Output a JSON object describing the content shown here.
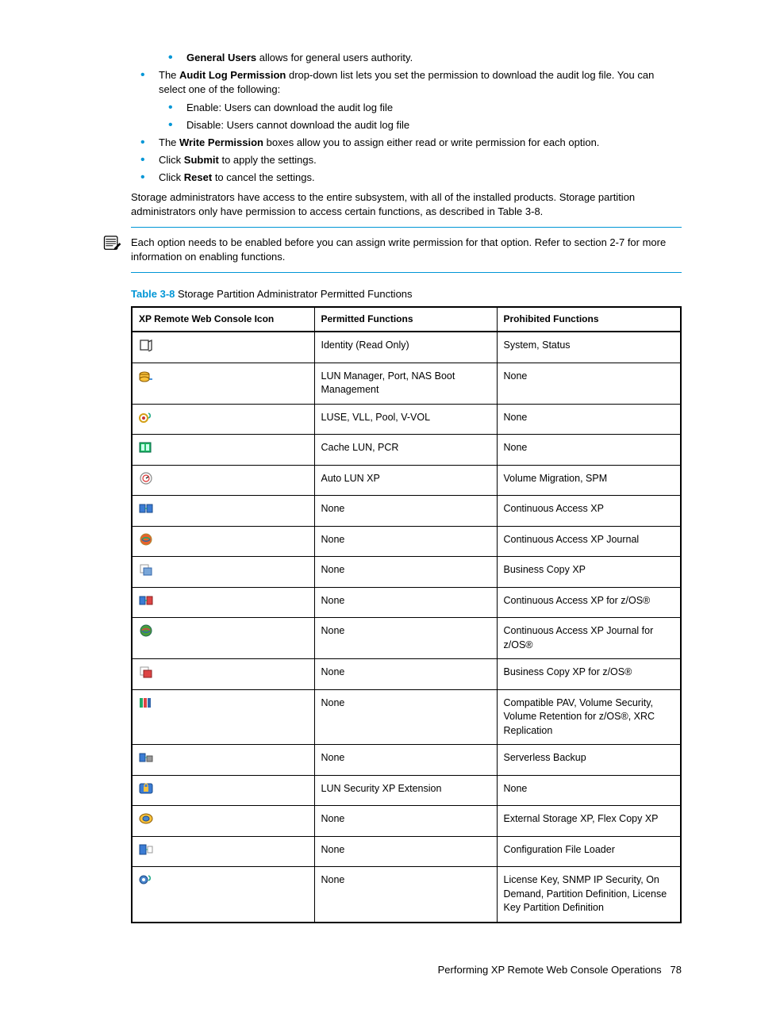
{
  "bullets_l2_top": [
    "General Users"
  ],
  "bullets_l2_top_desc": " allows for general users authority.",
  "bullet_audit_pre": "The ",
  "bullet_audit_bold": "Audit Log Permission",
  "bullet_audit_post": " drop-down list lets you set the permission to download the audit log file. You can select one of the following:",
  "audit_sub": [
    "Enable: Users can download the audit log file",
    "Disable: Users cannot download the audit log file"
  ],
  "bullet_write_pre": "The ",
  "bullet_write_bold": "Write Permission",
  "bullet_write_post": " boxes allow you to assign either read or write permission for each option.",
  "bullet_submit_pre": "Click ",
  "bullet_submit_bold": "Submit",
  "bullet_submit_post": " to apply the settings.",
  "bullet_reset_pre": "Click ",
  "bullet_reset_bold": "Reset",
  "bullet_reset_post": " to cancel the settings.",
  "para1": "Storage administrators have access to the entire subsystem, with all of the installed products. Storage partition administrators only have permission to access certain functions, as described in Table 3-8.",
  "note": "Each option needs to be enabled before you can assign write permission for that option. Refer to section 2-7 for more information on enabling functions.",
  "table_label": "Table 3-8",
  "table_caption": "  Storage Partition Administrator Permitted Functions",
  "headers": {
    "c1": "XP Remote Web Console Icon",
    "c2": "Permitted Functions",
    "c3": "Prohibited Functions"
  },
  "rows": [
    {
      "icon": "identity-icon",
      "permitted": "Identity (Read Only)",
      "prohibited": "System, Status"
    },
    {
      "icon": "lun-manager-icon",
      "permitted": "LUN Manager, Port, NAS Boot Management",
      "prohibited": "None"
    },
    {
      "icon": "luse-icon",
      "permitted": "LUSE, VLL, Pool, V-VOL",
      "prohibited": "None"
    },
    {
      "icon": "cache-lun-icon",
      "permitted": "Cache LUN, PCR",
      "prohibited": "None"
    },
    {
      "icon": "auto-lun-icon",
      "permitted": "Auto LUN XP",
      "prohibited": "Volume Migration, SPM"
    },
    {
      "icon": "ca-xp-icon",
      "permitted": "None",
      "prohibited": "Continuous Access XP"
    },
    {
      "icon": "ca-journal-icon",
      "permitted": "None",
      "prohibited": "Continuous Access XP Journal"
    },
    {
      "icon": "bc-xp-icon",
      "permitted": "None",
      "prohibited": "Business Copy XP"
    },
    {
      "icon": "ca-zos-icon",
      "permitted": "None",
      "prohibited": "Continuous Access XP for z/OS®"
    },
    {
      "icon": "ca-journal-zos-icon",
      "permitted": "None",
      "prohibited": "Continuous Access XP Journal for z/OS®"
    },
    {
      "icon": "bc-zos-icon",
      "permitted": "None",
      "prohibited": "Business Copy XP for z/OS®"
    },
    {
      "icon": "pav-icon",
      "permitted": "None",
      "prohibited": "Compatible PAV, Volume Security, Volume Retention for z/OS®, XRC Replication"
    },
    {
      "icon": "serverless-icon",
      "permitted": "None",
      "prohibited": "Serverless Backup"
    },
    {
      "icon": "lun-security-icon",
      "permitted": "LUN Security XP Extension",
      "prohibited": "None"
    },
    {
      "icon": "external-storage-icon",
      "permitted": "None",
      "prohibited": "External Storage XP, Flex Copy XP"
    },
    {
      "icon": "config-loader-icon",
      "permitted": "None",
      "prohibited": "Configuration File Loader"
    },
    {
      "icon": "license-key-icon",
      "permitted": "None",
      "prohibited": "License Key, SNMP IP Security, On Demand, Partition Definition, License Key Partition Definition"
    }
  ],
  "footer_text": "Performing XP Remote Web Console Operations",
  "footer_page": "78"
}
